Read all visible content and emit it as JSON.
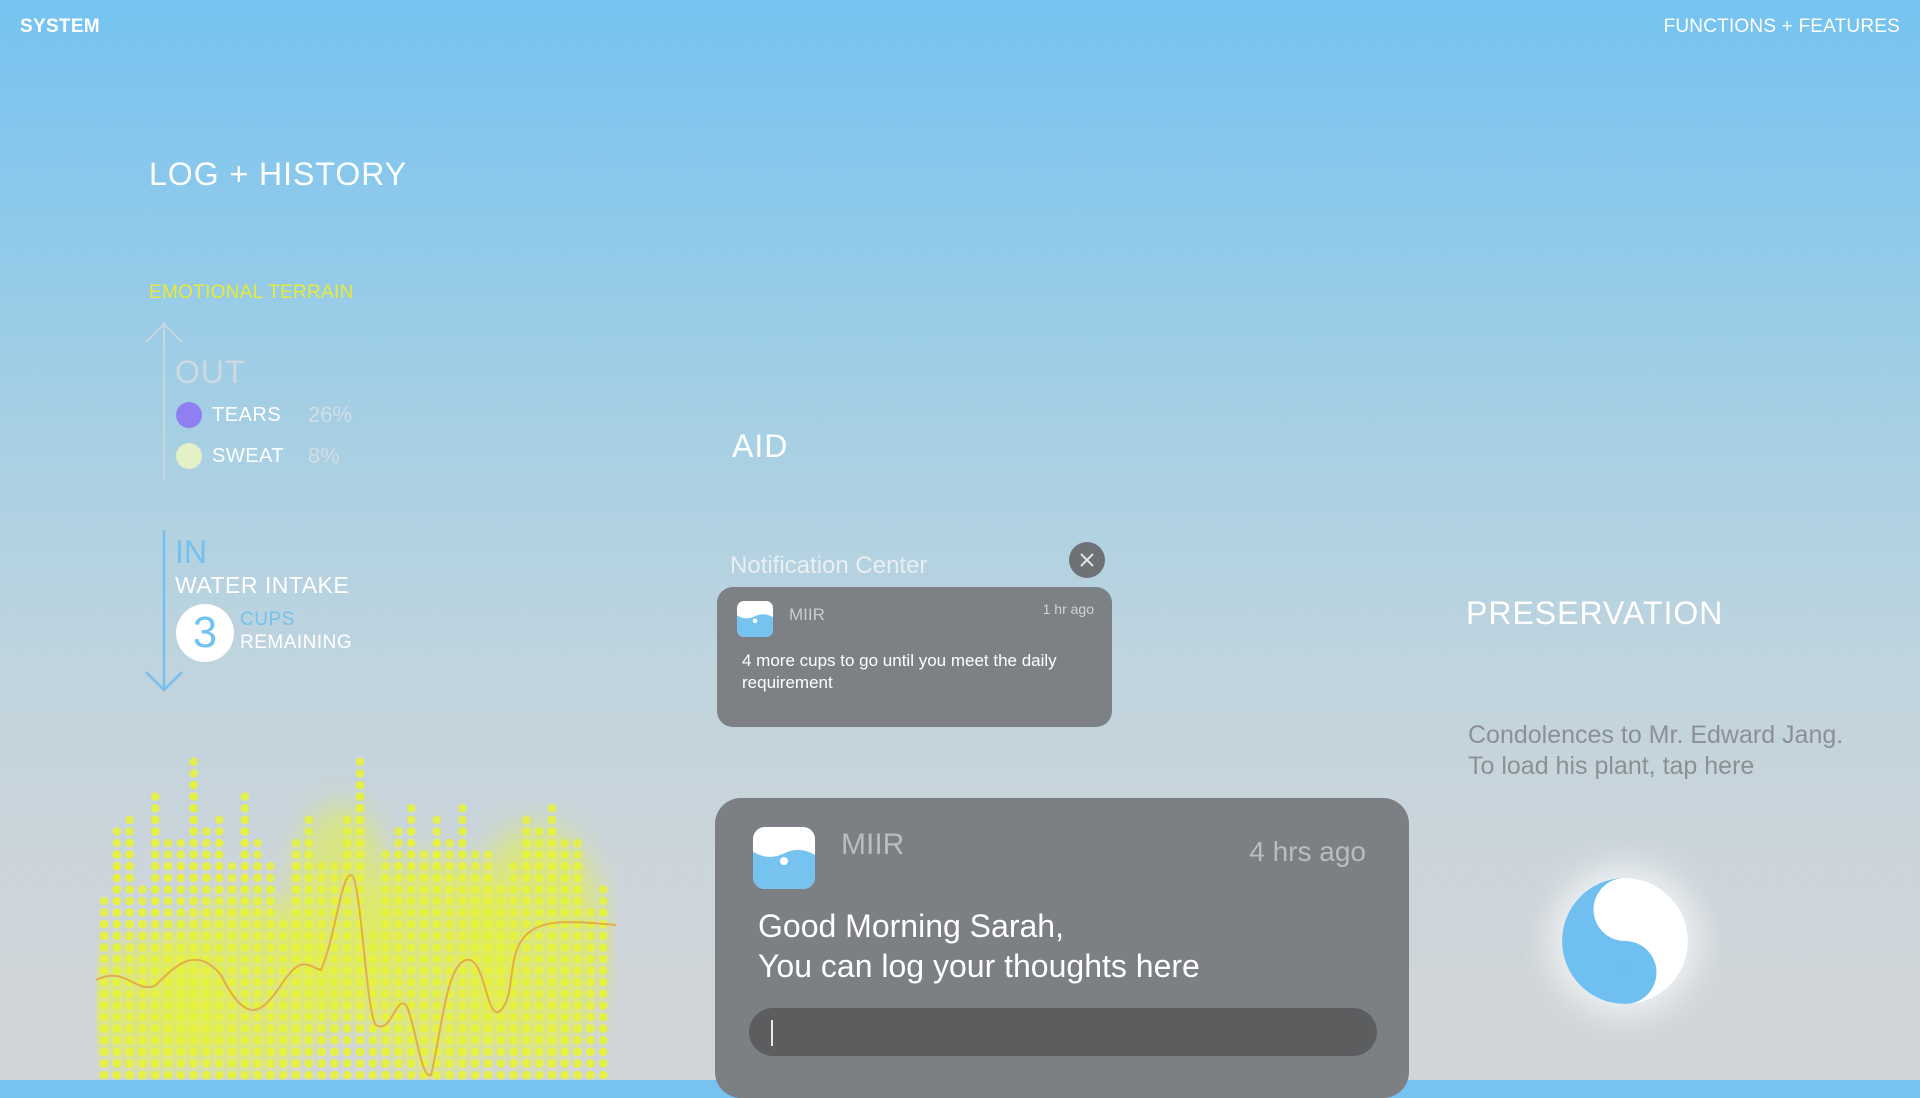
{
  "header": {
    "brand": "SYSTEM",
    "nav_link": "FUNCTIONS + FEATURES"
  },
  "log_history": {
    "title": "LOG + HISTORY",
    "terrain_title": "EMOTIONAL TERRAIN",
    "out": {
      "label": "OUT",
      "items": [
        {
          "name": "TEARS",
          "percent": "26%",
          "color": "#8f7ff2"
        },
        {
          "name": "SWEAT",
          "percent": "8%",
          "color": "#e4f0c8"
        }
      ]
    },
    "in": {
      "label": "IN",
      "water_label": "WATER INTAKE",
      "cups_count": "3",
      "cups_word": "CUPS",
      "cups_remaining": "REMAINING"
    }
  },
  "aid": {
    "title": "AID",
    "notification_center_title": "Notification  Center",
    "close_icon": "close-icon",
    "notifications": [
      {
        "app": "MIIR",
        "time": "1 hr ago",
        "message": "4 more cups to go until you meet the daily requirement"
      },
      {
        "app": "MIIR",
        "time": "4 hrs  ago",
        "greeting_line1": "Good Morning Sarah,",
        "greeting_line2": "You can log your thoughts here"
      }
    ]
  },
  "preservation": {
    "title": "PRESERVATION",
    "message_line1": "Condolences to Mr. Edward Jang.",
    "message_line2": "To load his plant, tap here",
    "icon": "yin-yang-icon"
  },
  "colors": {
    "accent_blue": "#74c2ef",
    "accent_yellow": "#e7ea36",
    "card_gray": "#7c7f83",
    "visualizer_dots": "#e6f23a",
    "visualizer_line": "#e3ad4c"
  }
}
